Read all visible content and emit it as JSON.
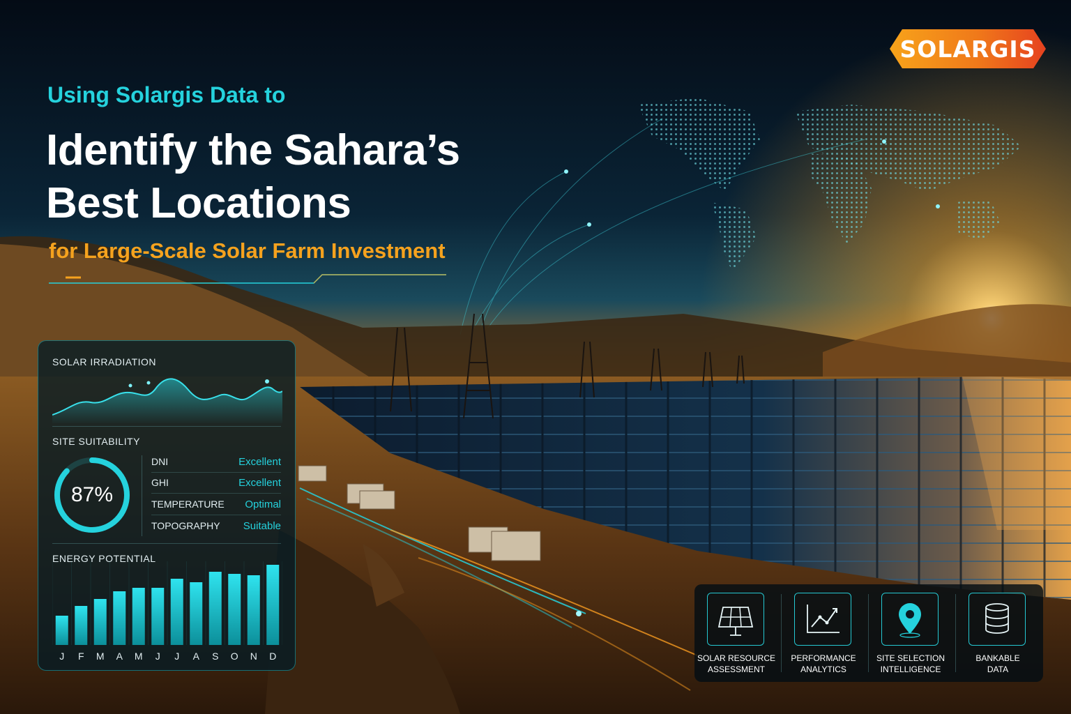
{
  "brand": {
    "logo_text": "SOLARGIS",
    "accent": "#25d2dd",
    "orange": "#f5a21e"
  },
  "headline": {
    "intro": "Using Solargis Data to",
    "title_line1": "Identify the Sahara’s",
    "title_line2": "Best Locations",
    "subtitle": "for Large-Scale Solar Farm Investment"
  },
  "dashboard": {
    "irradiation": {
      "title": "SOLAR IRRADIATION"
    },
    "suitability": {
      "title": "SITE SUITABILITY",
      "score_label": "87%",
      "score_fraction": 0.87,
      "metrics": [
        {
          "name": "DNI",
          "value": "Excellent"
        },
        {
          "name": "GHI",
          "value": "Excellent"
        },
        {
          "name": "TEMPERATURE",
          "value": "Optimal"
        },
        {
          "name": "TOPOGRAPHY",
          "value": "Suitable"
        }
      ]
    },
    "energy": {
      "title": "ENERGY POTENTIAL",
      "months": [
        "J",
        "F",
        "M",
        "A",
        "M",
        "J",
        "J",
        "A",
        "S",
        "O",
        "N",
        "D"
      ],
      "values": [
        42,
        56,
        66,
        77,
        82,
        82,
        95,
        90,
        105,
        102,
        100,
        115
      ]
    }
  },
  "features": [
    {
      "icon": "solar-panel-icon",
      "line1": "SOLAR RESOURCE",
      "line2": "ASSESSMENT"
    },
    {
      "icon": "line-chart-icon",
      "line1": "PERFORMANCE",
      "line2": "ANALYTICS"
    },
    {
      "icon": "map-pin-icon",
      "line1": "SITE SELECTION",
      "line2": "INTELLIGENCE"
    },
    {
      "icon": "database-icon",
      "line1": "BANKABLE",
      "line2": "DATA"
    }
  ]
}
